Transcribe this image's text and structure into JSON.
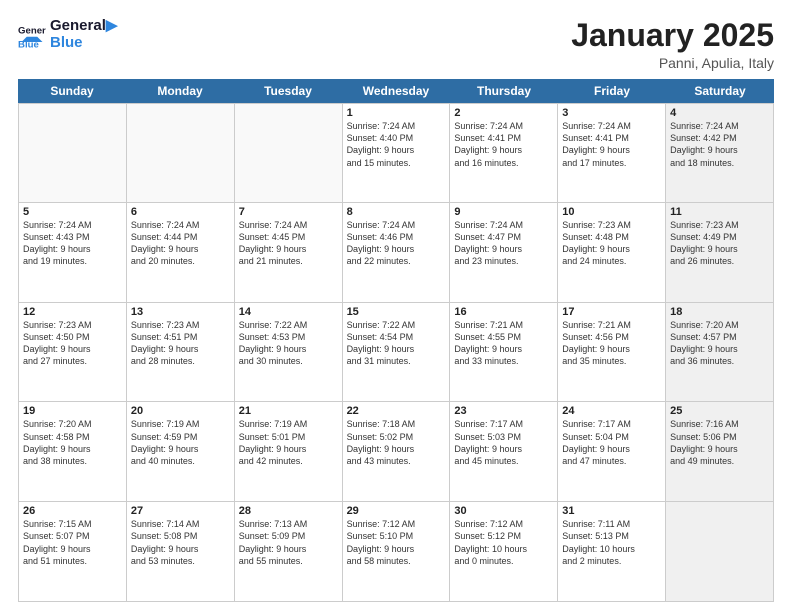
{
  "header": {
    "logo_general": "General",
    "logo_blue": "Blue",
    "month_title": "January 2025",
    "location": "Panni, Apulia, Italy"
  },
  "weekdays": [
    "Sunday",
    "Monday",
    "Tuesday",
    "Wednesday",
    "Thursday",
    "Friday",
    "Saturday"
  ],
  "weeks": [
    [
      {
        "day": "",
        "text": "",
        "empty": true
      },
      {
        "day": "",
        "text": "",
        "empty": true
      },
      {
        "day": "",
        "text": "",
        "empty": true
      },
      {
        "day": "1",
        "text": "Sunrise: 7:24 AM\nSunset: 4:40 PM\nDaylight: 9 hours\nand 15 minutes."
      },
      {
        "day": "2",
        "text": "Sunrise: 7:24 AM\nSunset: 4:41 PM\nDaylight: 9 hours\nand 16 minutes."
      },
      {
        "day": "3",
        "text": "Sunrise: 7:24 AM\nSunset: 4:41 PM\nDaylight: 9 hours\nand 17 minutes."
      },
      {
        "day": "4",
        "text": "Sunrise: 7:24 AM\nSunset: 4:42 PM\nDaylight: 9 hours\nand 18 minutes.",
        "shaded": true
      }
    ],
    [
      {
        "day": "5",
        "text": "Sunrise: 7:24 AM\nSunset: 4:43 PM\nDaylight: 9 hours\nand 19 minutes."
      },
      {
        "day": "6",
        "text": "Sunrise: 7:24 AM\nSunset: 4:44 PM\nDaylight: 9 hours\nand 20 minutes."
      },
      {
        "day": "7",
        "text": "Sunrise: 7:24 AM\nSunset: 4:45 PM\nDaylight: 9 hours\nand 21 minutes."
      },
      {
        "day": "8",
        "text": "Sunrise: 7:24 AM\nSunset: 4:46 PM\nDaylight: 9 hours\nand 22 minutes."
      },
      {
        "day": "9",
        "text": "Sunrise: 7:24 AM\nSunset: 4:47 PM\nDaylight: 9 hours\nand 23 minutes."
      },
      {
        "day": "10",
        "text": "Sunrise: 7:23 AM\nSunset: 4:48 PM\nDaylight: 9 hours\nand 24 minutes."
      },
      {
        "day": "11",
        "text": "Sunrise: 7:23 AM\nSunset: 4:49 PM\nDaylight: 9 hours\nand 26 minutes.",
        "shaded": true
      }
    ],
    [
      {
        "day": "12",
        "text": "Sunrise: 7:23 AM\nSunset: 4:50 PM\nDaylight: 9 hours\nand 27 minutes."
      },
      {
        "day": "13",
        "text": "Sunrise: 7:23 AM\nSunset: 4:51 PM\nDaylight: 9 hours\nand 28 minutes."
      },
      {
        "day": "14",
        "text": "Sunrise: 7:22 AM\nSunset: 4:53 PM\nDaylight: 9 hours\nand 30 minutes."
      },
      {
        "day": "15",
        "text": "Sunrise: 7:22 AM\nSunset: 4:54 PM\nDaylight: 9 hours\nand 31 minutes."
      },
      {
        "day": "16",
        "text": "Sunrise: 7:21 AM\nSunset: 4:55 PM\nDaylight: 9 hours\nand 33 minutes."
      },
      {
        "day": "17",
        "text": "Sunrise: 7:21 AM\nSunset: 4:56 PM\nDaylight: 9 hours\nand 35 minutes."
      },
      {
        "day": "18",
        "text": "Sunrise: 7:20 AM\nSunset: 4:57 PM\nDaylight: 9 hours\nand 36 minutes.",
        "shaded": true
      }
    ],
    [
      {
        "day": "19",
        "text": "Sunrise: 7:20 AM\nSunset: 4:58 PM\nDaylight: 9 hours\nand 38 minutes."
      },
      {
        "day": "20",
        "text": "Sunrise: 7:19 AM\nSunset: 4:59 PM\nDaylight: 9 hours\nand 40 minutes."
      },
      {
        "day": "21",
        "text": "Sunrise: 7:19 AM\nSunset: 5:01 PM\nDaylight: 9 hours\nand 42 minutes."
      },
      {
        "day": "22",
        "text": "Sunrise: 7:18 AM\nSunset: 5:02 PM\nDaylight: 9 hours\nand 43 minutes."
      },
      {
        "day": "23",
        "text": "Sunrise: 7:17 AM\nSunset: 5:03 PM\nDaylight: 9 hours\nand 45 minutes."
      },
      {
        "day": "24",
        "text": "Sunrise: 7:17 AM\nSunset: 5:04 PM\nDaylight: 9 hours\nand 47 minutes."
      },
      {
        "day": "25",
        "text": "Sunrise: 7:16 AM\nSunset: 5:06 PM\nDaylight: 9 hours\nand 49 minutes.",
        "shaded": true
      }
    ],
    [
      {
        "day": "26",
        "text": "Sunrise: 7:15 AM\nSunset: 5:07 PM\nDaylight: 9 hours\nand 51 minutes."
      },
      {
        "day": "27",
        "text": "Sunrise: 7:14 AM\nSunset: 5:08 PM\nDaylight: 9 hours\nand 53 minutes."
      },
      {
        "day": "28",
        "text": "Sunrise: 7:13 AM\nSunset: 5:09 PM\nDaylight: 9 hours\nand 55 minutes."
      },
      {
        "day": "29",
        "text": "Sunrise: 7:12 AM\nSunset: 5:10 PM\nDaylight: 9 hours\nand 58 minutes."
      },
      {
        "day": "30",
        "text": "Sunrise: 7:12 AM\nSunset: 5:12 PM\nDaylight: 10 hours\nand 0 minutes."
      },
      {
        "day": "31",
        "text": "Sunrise: 7:11 AM\nSunset: 5:13 PM\nDaylight: 10 hours\nand 2 minutes."
      },
      {
        "day": "",
        "text": "",
        "empty": true,
        "shaded": true
      }
    ]
  ]
}
